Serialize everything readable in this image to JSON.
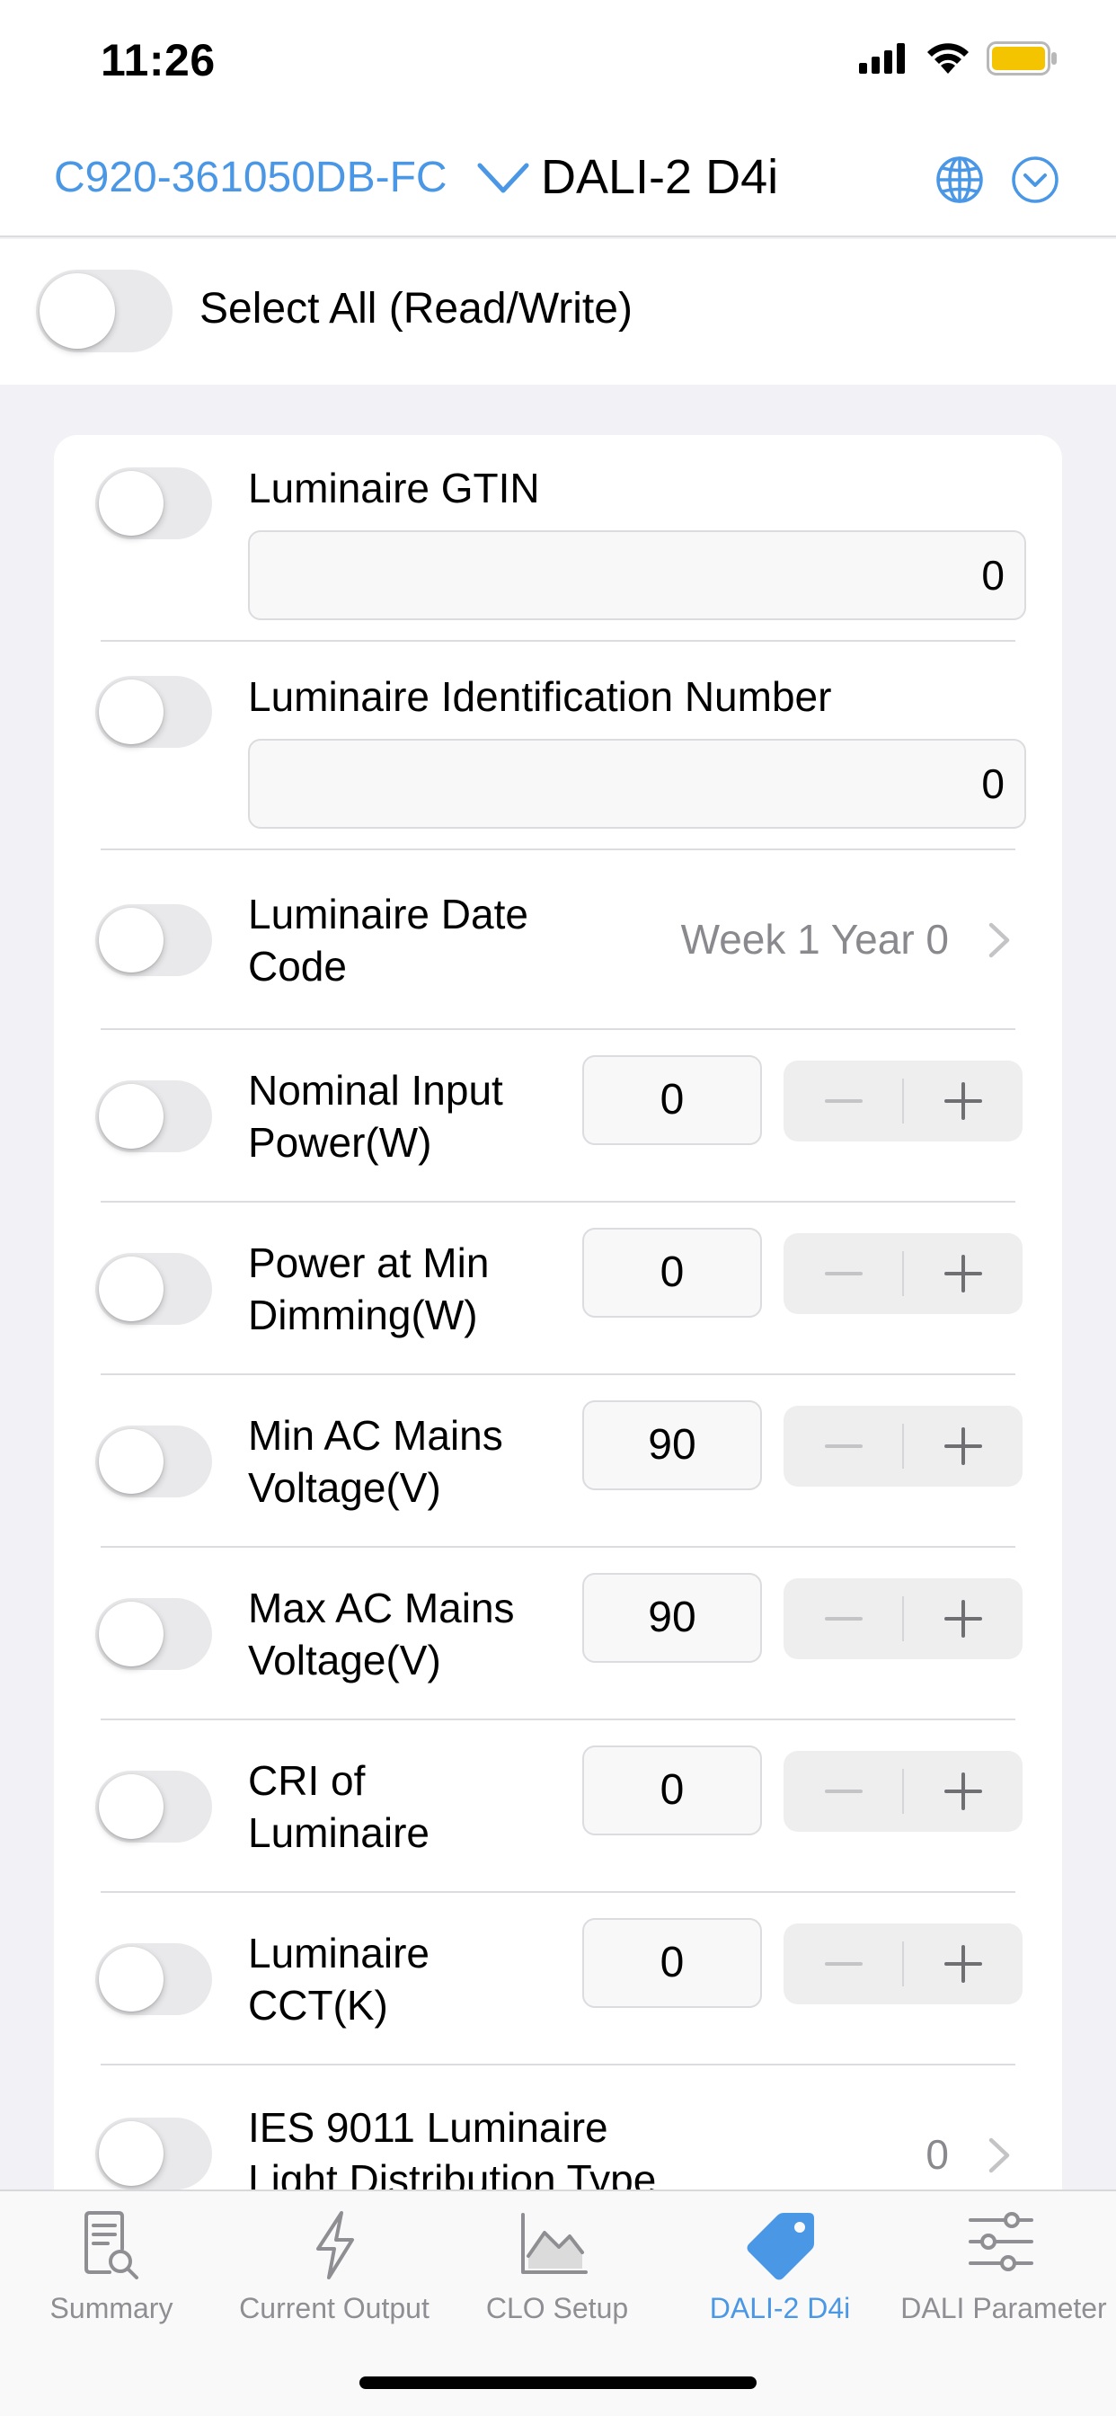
{
  "status_bar": {
    "time": "11:26"
  },
  "nav": {
    "device_name": "C920-361050DB-FC",
    "title": "DALI-2 D4i"
  },
  "select_all": {
    "label": "Select All (Read/Write)"
  },
  "fields": [
    {
      "label": "Luminaire GTIN",
      "value": "0"
    },
    {
      "label": "Luminaire Identification Number",
      "value": "0"
    },
    {
      "label_line1": "Luminaire Date",
      "label_line2": "Code",
      "value": "Week 1 Year 0"
    },
    {
      "label_line1": "Nominal Input",
      "label_line2": "Power(W)",
      "value": "0"
    },
    {
      "label_line1": "Power at Min",
      "label_line2": "Dimming(W)",
      "value": "0"
    },
    {
      "label_line1": "Min AC Mains",
      "label_line2": "Voltage(V)",
      "value": "90"
    },
    {
      "label_line1": "Max AC Mains",
      "label_line2": "Voltage(V)",
      "value": "90"
    },
    {
      "label_line1": "CRI of",
      "label_line2": "Luminaire",
      "value": "0"
    },
    {
      "label_line1": "Luminaire",
      "label_line2": "CCT(K)",
      "value": "0"
    },
    {
      "label_line1": "IES 9011 Luminaire",
      "label_line2": "Light Distribution Type",
      "value": "0"
    }
  ],
  "tabs": [
    {
      "label": "Summary",
      "icon": "document-search-icon"
    },
    {
      "label": "Current Output",
      "icon": "bolt-icon"
    },
    {
      "label": "CLO Setup",
      "icon": "chart-icon"
    },
    {
      "label": "DALI-2 D4i",
      "icon": "tag-icon",
      "active": true
    },
    {
      "label": "DALI Parameter",
      "icon": "sliders-icon"
    }
  ],
  "colors": {
    "accent": "#4a97e6",
    "battery": "#f5c400",
    "background": "#f1f1f6"
  }
}
